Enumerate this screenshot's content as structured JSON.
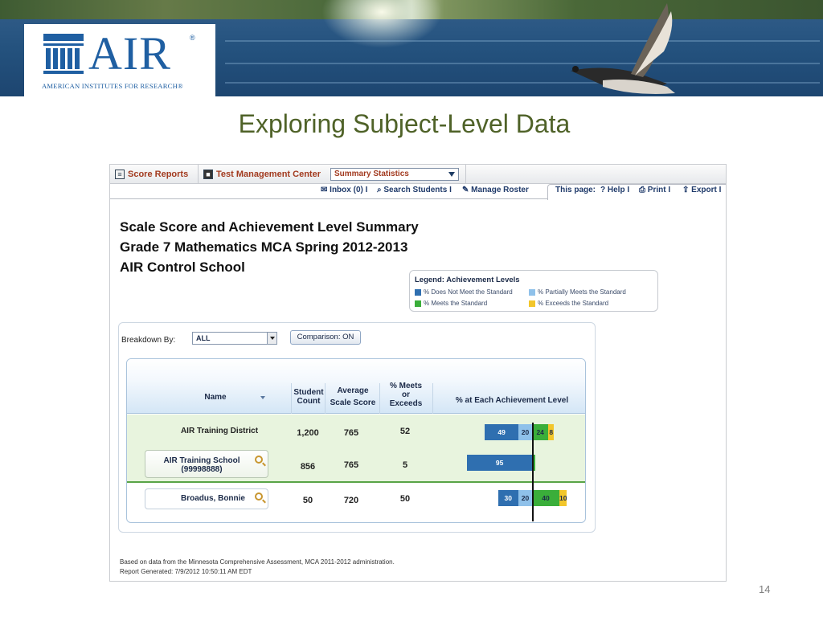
{
  "banner": {
    "logo_text": "AIR",
    "logo_reg": "®",
    "logo_subtitle": "American Institutes for Research®"
  },
  "slide": {
    "title": "Exploring Subject-Level Data",
    "page_number": "14"
  },
  "app": {
    "tabs": [
      {
        "label": "Score Reports",
        "icon": "report-icon"
      },
      {
        "label": "Test Management Center",
        "icon": "lock-icon"
      }
    ],
    "summary_select": "Summary Statistics",
    "subnav": {
      "inbox": "Inbox (0) I",
      "search_students": "Search Students I",
      "manage_roster": "Manage Roster",
      "this_page": "This page:",
      "help": "Help I",
      "print": "Print I",
      "export": "Export I"
    },
    "report": {
      "title1": "Scale Score and Achievement Level Summary",
      "title2": "Grade 7 Mathematics MCA Spring 2012-2013",
      "title3": "AIR Control School"
    },
    "legend": {
      "title": "Legend: Achievement Levels",
      "items": [
        {
          "label": "% Does Not Meet the Standard",
          "color": "#2f6fb0"
        },
        {
          "label": "% Partially Meets the Standard",
          "color": "#8fc1ea"
        },
        {
          "label": "% Meets the Standard",
          "color": "#3aae3a"
        },
        {
          "label": "% Exceeds the Standard",
          "color": "#f2c62b"
        }
      ]
    },
    "breakdown": {
      "label": "Breakdown By:",
      "value": "ALL",
      "comparison_button": "Comparison: ON"
    },
    "table": {
      "headers": {
        "name": "Name",
        "student_count_1": "Student",
        "student_count_2": "Count",
        "avg_1": "Average",
        "avg_2": "Scale Score",
        "meets_1": "% Meets",
        "meets_2": "or",
        "meets_3": "Exceeds",
        "levels": "% at Each Achievement Level"
      },
      "rows": [
        {
          "name": "AIR Training District",
          "name2": "",
          "count": "1,200",
          "avg": "765",
          "meets": "52",
          "levels": [
            49,
            20,
            24,
            8
          ],
          "labels": [
            "49",
            "20",
            "24",
            "8"
          ]
        },
        {
          "name": "AIR Training School",
          "name2": "(99998888)",
          "count": "856",
          "avg": "765",
          "meets": "5",
          "levels": [
            95,
            0,
            5,
            0
          ],
          "labels": [
            "95",
            "",
            "",
            ""
          ]
        },
        {
          "name": "Broadus, Bonnie",
          "name2": "",
          "count": "50",
          "avg": "720",
          "meets": "50",
          "levels": [
            30,
            20,
            40,
            10
          ],
          "labels": [
            "30",
            "20",
            "40",
            "10"
          ]
        }
      ]
    },
    "footer": {
      "line1": "Based on data from the Minnesota Comprehensive Assessment, MCA 2011-2012 administration.",
      "line2": "Report Generated: 7/9/2012 10:50:11 AM EDT"
    }
  }
}
